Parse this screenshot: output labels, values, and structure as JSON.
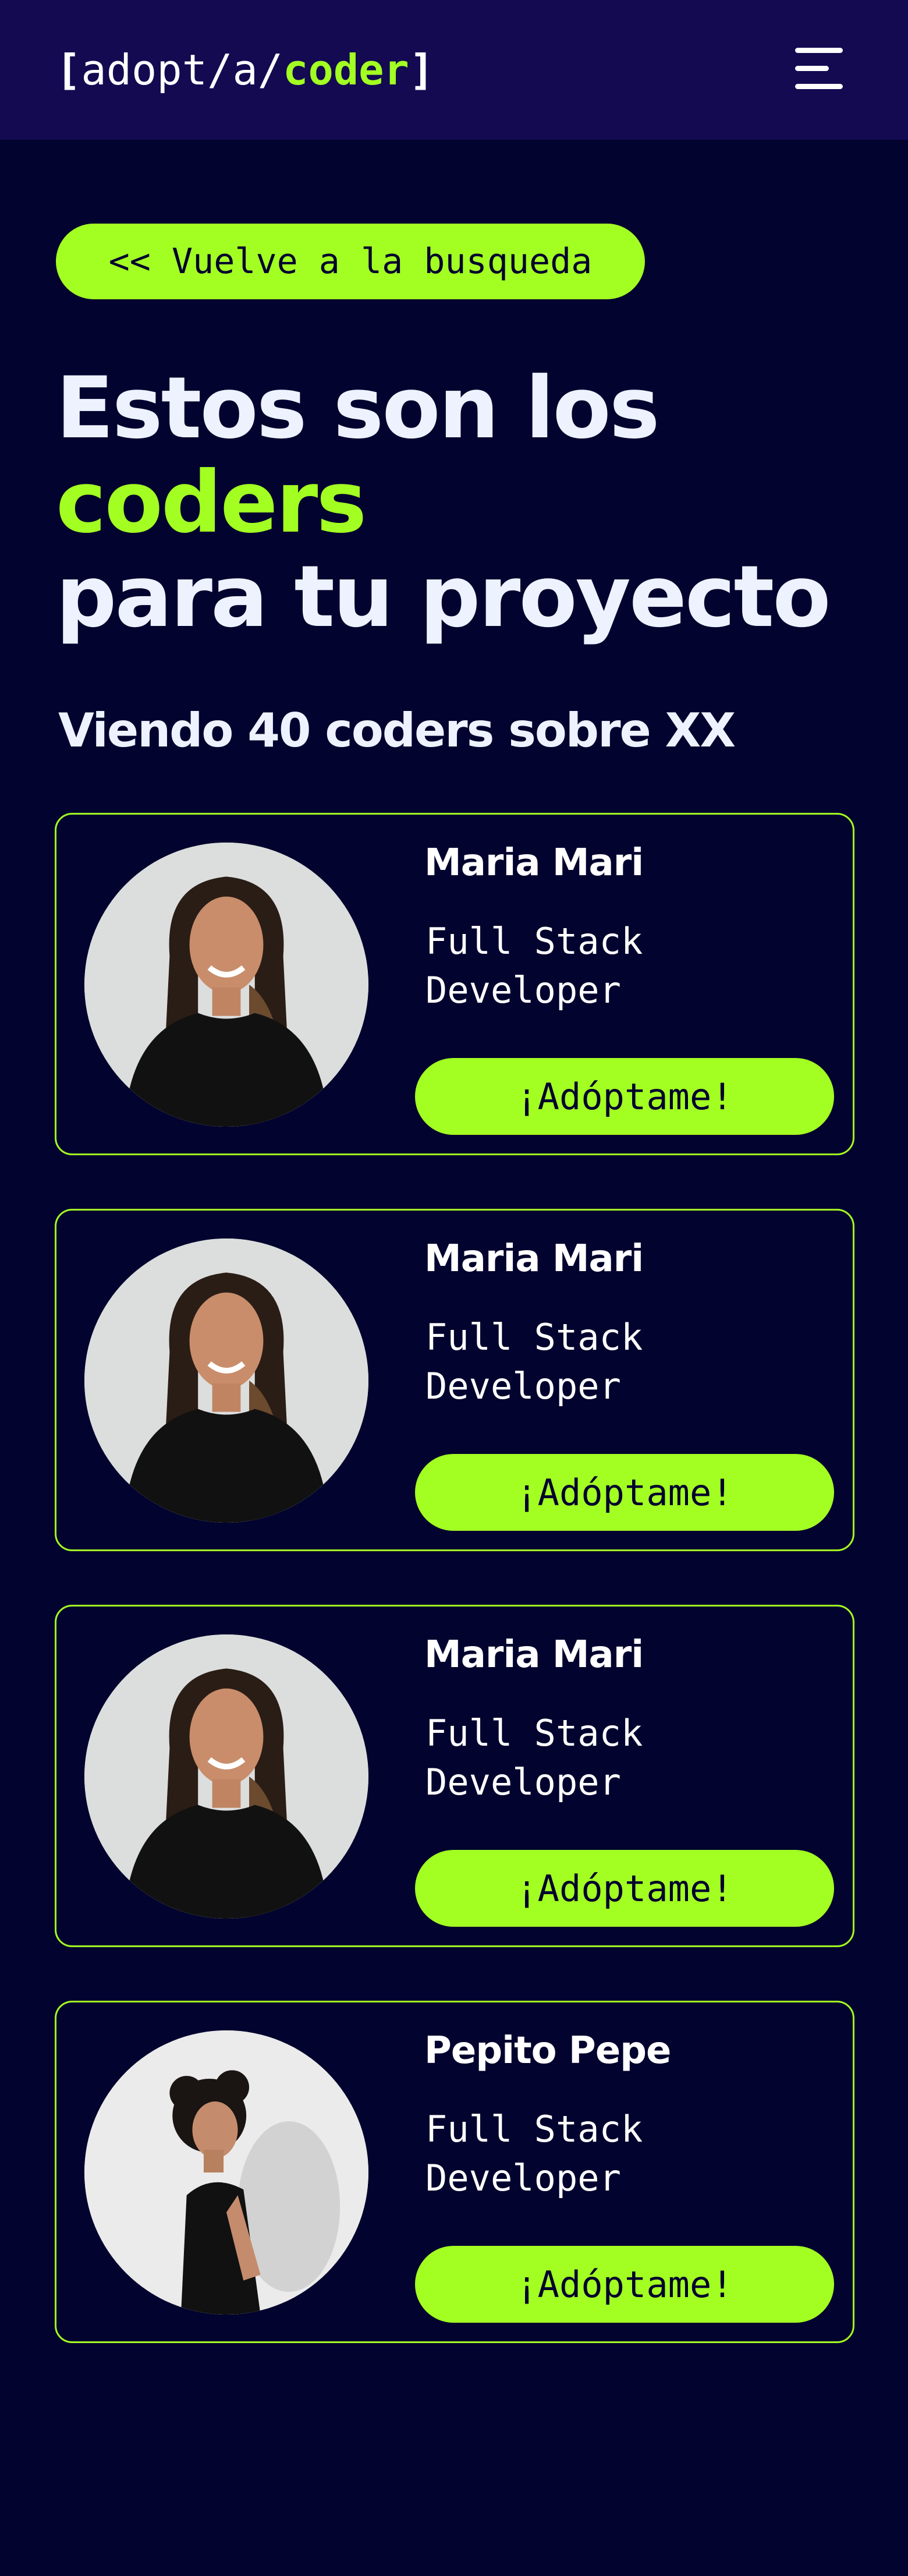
{
  "header": {
    "logo": {
      "open": "[",
      "part1": "adopt/a/",
      "accent": "coder",
      "close": "]"
    },
    "menu_icon": "hamburger-menu-icon"
  },
  "back_button": {
    "label": "<< Vuelve a la busqueda"
  },
  "headline": {
    "line1": "Estos son los",
    "line2": "coders",
    "line3": "para tu proyecto"
  },
  "results_summary": "Viendo 40 coders sobre XX",
  "coders": [
    {
      "name": "Maria Mari",
      "role": "Full Stack Developer",
      "cta": "¡Adóptame!",
      "photo": "woman-portrait"
    },
    {
      "name": "Maria Mari",
      "role": "Full Stack Developer",
      "cta": "¡Adóptame!",
      "photo": "woman-portrait"
    },
    {
      "name": "Maria Mari",
      "role": "Full Stack Developer",
      "cta": "¡Adóptame!",
      "photo": "woman-portrait"
    },
    {
      "name": "Pepito Pepe",
      "role": "Full Stack Developer",
      "cta": "¡Adóptame!",
      "photo": "man-portrait"
    }
  ],
  "colors": {
    "background": "#02032e",
    "header": "#130a52",
    "accent": "#a3ff22",
    "text": "#ffffff"
  }
}
